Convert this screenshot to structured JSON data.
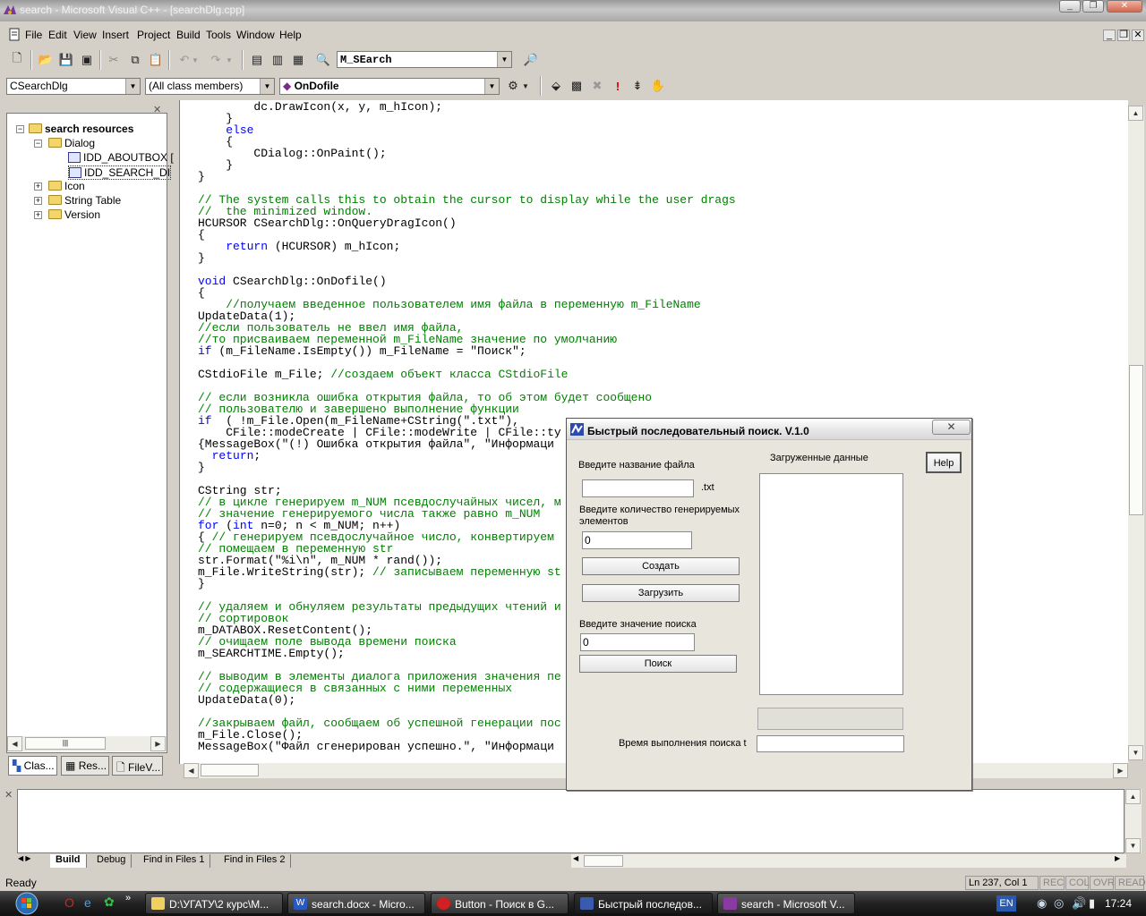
{
  "window": {
    "title": "search - Microsoft Visual C++ - [searchDlg.cpp]"
  },
  "menu": {
    "items": [
      "File",
      "Edit",
      "View",
      "Insert",
      "Project",
      "Build",
      "Tools",
      "Window",
      "Help"
    ]
  },
  "toolbar": {
    "find_combo": "M_SEarch",
    "class_combo": "CSearchDlg",
    "filter_combo": "(All class members)",
    "member_combo": "OnDofile"
  },
  "workspace": {
    "root": "search resources",
    "dialog_folder": "Dialog",
    "dialog_items": [
      "IDD_ABOUTBOX [",
      "IDD_SEARCH_DI"
    ],
    "folders": [
      "Icon",
      "String Table",
      "Version"
    ],
    "tabs": [
      "Clas...",
      "Res...",
      "FileV..."
    ]
  },
  "code_lines": [
    "        dc.DrawIcon(x, y, m_hIcon);",
    "    }",
    "    else",
    "    {",
    "        CDialog::OnPaint();",
    "    }",
    "}",
    "",
    "// The system calls this to obtain the cursor to display while the user drags",
    "//  the minimized window.",
    "HCURSOR CSearchDlg::OnQueryDragIcon()",
    "{",
    "    return (HCURSOR) m_hIcon;",
    "}",
    "",
    "void CSearchDlg::OnDofile()",
    "{",
    "    //получаем введенное пользователем имя файла в переменную m_FileName",
    "UpdateData(1);",
    "//если пользователь не ввел имя файла,",
    "//то присваиваем переменной m_FileName значение по умолчанию",
    "if (m_FileName.IsEmpty()) m_FileName = \"Поиск\";",
    "",
    "CStdioFile m_File; //создаем объект класса CStdioFile",
    "",
    "// если возникла ошибка открытия файла, то об этом будет сообщено",
    "// пользователю и завершено выполнение функции",
    "if  ( !m_File.Open(m_FileName+CString(\".txt\"),",
    "    CFile::modeCreate | CFile::modeWrite | CFile::ty",
    "{MessageBox(\"(!) Ошибка открытия файла\", \"Информаци",
    "  return;",
    "}",
    "",
    "CString str;",
    "// в цикле генерируем m_NUM псевдослучайных чисел, м",
    "// значение генерируемого числа также равно m_NUM",
    "for (int n=0; n < m_NUM; n++)",
    "{ // генерируем псевдослучайное число, конвертируем",
    "// помещаем в переменную str",
    "str.Format(\"%i\\n\", m_NUM * rand());",
    "m_File.WriteString(str); // записываем переменную st",
    "}",
    "",
    "// удаляем и обнуляем результаты предыдущих чтений и",
    "// сортировок",
    "m_DATABOX.ResetContent();",
    "// очищаем поле вывода времени поиска",
    "m_SEARCHTIME.Empty();",
    "",
    "// выводим в элементы диалога приложения значения пе",
    "// содержащиеся в связанных с ними переменных",
    "UpdateData(0);",
    "",
    "//закрываем файл, сообщаем об успешной генерации пос",
    "m_File.Close();",
    "MessageBox(\"Файл сгенерирован успешно.\", \"Информаци"
  ],
  "output": {
    "tabs": [
      "Build",
      "Debug",
      "Find in Files 1",
      "Find in Files 2"
    ]
  },
  "status": {
    "text": "Ready",
    "position": "Ln 237, Col 1",
    "indicators": [
      "REC",
      "COL",
      "OVR",
      "READ"
    ]
  },
  "taskbar": {
    "tasks": [
      "D:\\УГАТУ\\2 курс\\М...",
      "search.docx - Micro...",
      "Button - Поиск в G...",
      "Быстрый последов...",
      "search - Microsoft V..."
    ],
    "lang": "EN",
    "clock": "17:24"
  },
  "dialog": {
    "title": "Быстрый последовательный поиск. V.1.0",
    "close": "✕",
    "file_label": "Введите название файла",
    "file_value": "",
    "file_ext": ".txt",
    "count_label": "Введите количество генерируемых элементов",
    "count_value": "0",
    "create_btn": "Создать",
    "load_btn": "Загрузить",
    "search_label": "Введите значение поиска",
    "search_value": "0",
    "search_btn": "Поиск",
    "loaded_label": "Загруженные данные",
    "help_btn": "Help",
    "time_label": "Время выполнения поиска t",
    "time_value": ""
  }
}
